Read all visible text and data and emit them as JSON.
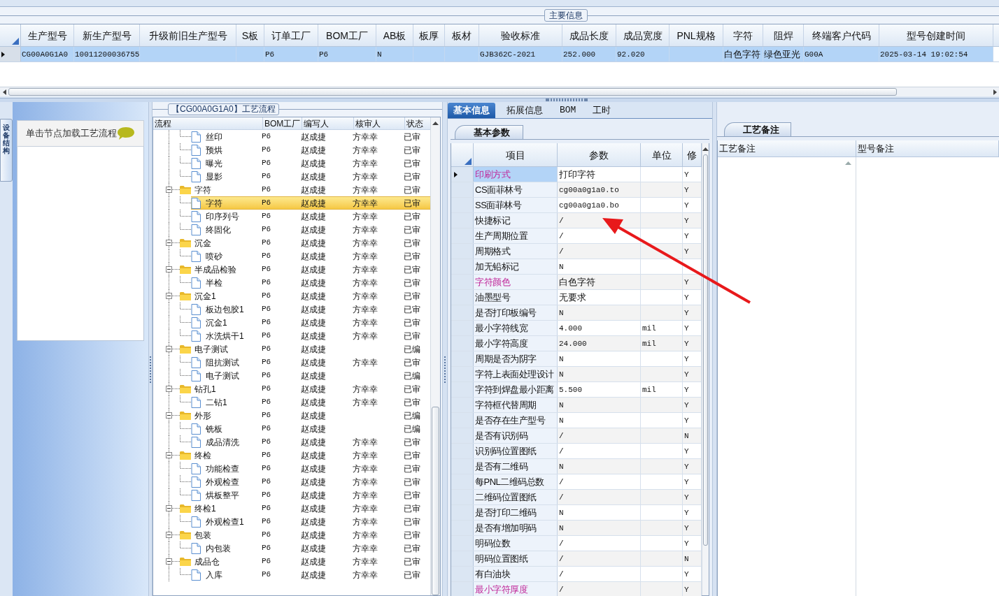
{
  "main_info": {
    "title": "主要信息",
    "row_selected": true,
    "columns": [
      {
        "header": "生产型号",
        "value": "CG00A0G1A0"
      },
      {
        "header": "新生产型号",
        "value": "10011200036755"
      },
      {
        "header": "升级前旧生产型号"
      },
      {
        "header": "S板"
      },
      {
        "header": "订单工厂",
        "value": "P6"
      },
      {
        "header": "BOM工厂",
        "value": "P6"
      },
      {
        "header": "AB板",
        "value": "N"
      },
      {
        "header": "板厚"
      },
      {
        "header": "板材"
      },
      {
        "header": "验收标准",
        "value": "GJB362C-2021"
      },
      {
        "header": "成品长度",
        "value": "252.000"
      },
      {
        "header": "成品宽度",
        "value": "92.020"
      },
      {
        "header": "PNL规格"
      },
      {
        "header": "字符",
        "value": "白色字符"
      },
      {
        "header": "阻焊",
        "value": "绿色亚光"
      },
      {
        "header": "终端客户代码",
        "value": "G00A"
      },
      {
        "header": "型号创建时间",
        "value": "2025-03-14 19:02:54"
      }
    ]
  },
  "side_tab": {
    "label": "设备结构"
  },
  "equipment_panel": {
    "hint": "单击节点加载工艺流程"
  },
  "process_flow": {
    "title": "【CG00A0G1A0】工艺流程",
    "columns": [
      "流程",
      "BOM工厂",
      "编写人",
      "核审人",
      "状态"
    ],
    "nodes": [
      {
        "kind": "step",
        "name": "丝印",
        "factory": "P6",
        "writer": "赵成捷",
        "reviewer": "方幸幸",
        "status": "已审",
        "selected": false
      },
      {
        "kind": "step",
        "name": "预烘",
        "factory": "P6",
        "writer": "赵成捷",
        "reviewer": "方幸幸",
        "status": "已审",
        "selected": false
      },
      {
        "kind": "step",
        "name": "曝光",
        "factory": "P6",
        "writer": "赵成捷",
        "reviewer": "方幸幸",
        "status": "已审",
        "selected": false
      },
      {
        "kind": "step",
        "name": "显影",
        "factory": "P6",
        "writer": "赵成捷",
        "reviewer": "方幸幸",
        "status": "已审",
        "selected": false
      },
      {
        "kind": "folder",
        "name": "字符",
        "factory": "P6",
        "writer": "赵成捷",
        "reviewer": "方幸幸",
        "status": "已审",
        "selected": false,
        "expanded": true,
        "children": [
          {
            "kind": "step",
            "name": "字符",
            "factory": "P6",
            "writer": "赵成捷",
            "reviewer": "方幸幸",
            "status": "已审",
            "selected": true
          },
          {
            "kind": "step",
            "name": "印序列号",
            "factory": "P6",
            "writer": "赵成捷",
            "reviewer": "方幸幸",
            "status": "已审",
            "selected": false
          },
          {
            "kind": "step",
            "name": "终固化",
            "factory": "P6",
            "writer": "赵成捷",
            "reviewer": "方幸幸",
            "status": "已审",
            "selected": false
          }
        ]
      },
      {
        "kind": "folder",
        "name": "沉金",
        "factory": "P6",
        "writer": "赵成捷",
        "reviewer": "方幸幸",
        "status": "已审",
        "selected": false,
        "expanded": true,
        "children": [
          {
            "kind": "step",
            "name": "喷砂",
            "factory": "P6",
            "writer": "赵成捷",
            "reviewer": "方幸幸",
            "status": "已审",
            "selected": false
          }
        ]
      },
      {
        "kind": "folder",
        "name": "半成品检验",
        "factory": "P6",
        "writer": "赵成捷",
        "reviewer": "方幸幸",
        "status": "已审",
        "selected": false,
        "expanded": true,
        "children": [
          {
            "kind": "step",
            "name": "半检",
            "factory": "P6",
            "writer": "赵成捷",
            "reviewer": "方幸幸",
            "status": "已审",
            "selected": false
          }
        ]
      },
      {
        "kind": "folder",
        "name": "沉金1",
        "factory": "P6",
        "writer": "赵成捷",
        "reviewer": "方幸幸",
        "status": "已审",
        "selected": false,
        "expanded": true,
        "children": [
          {
            "kind": "step",
            "name": "板边包胶1",
            "factory": "P6",
            "writer": "赵成捷",
            "reviewer": "方幸幸",
            "status": "已审",
            "selected": false
          },
          {
            "kind": "step",
            "name": "沉金1",
            "factory": "P6",
            "writer": "赵成捷",
            "reviewer": "方幸幸",
            "status": "已审",
            "selected": false
          },
          {
            "kind": "step",
            "name": "水洗烘干1",
            "factory": "P6",
            "writer": "赵成捷",
            "reviewer": "方幸幸",
            "status": "已审",
            "selected": false
          }
        ]
      },
      {
        "kind": "folder",
        "name": "电子测试",
        "factory": "P6",
        "writer": "赵成捷",
        "status": "已编",
        "selected": false,
        "expanded": true,
        "children": [
          {
            "kind": "step",
            "name": "阻抗测试",
            "factory": "P6",
            "writer": "赵成捷",
            "reviewer": "方幸幸",
            "status": "已审",
            "selected": false
          },
          {
            "kind": "step",
            "name": "电子测试",
            "factory": "P6",
            "writer": "赵成捷",
            "status": "已编",
            "selected": false
          }
        ]
      },
      {
        "kind": "folder",
        "name": "钻孔1",
        "factory": "P6",
        "writer": "赵成捷",
        "reviewer": "方幸幸",
        "status": "已审",
        "selected": false,
        "expanded": true,
        "children": [
          {
            "kind": "step",
            "name": "二钻1",
            "factory": "P6",
            "writer": "赵成捷",
            "reviewer": "方幸幸",
            "status": "已审",
            "selected": false
          }
        ]
      },
      {
        "kind": "folder",
        "name": "外形",
        "factory": "P6",
        "writer": "赵成捷",
        "status": "已编",
        "selected": false,
        "expanded": true,
        "children": [
          {
            "kind": "step",
            "name": "铣板",
            "factory": "P6",
            "writer": "赵成捷",
            "status": "已编",
            "selected": false
          },
          {
            "kind": "step",
            "name": "成品清洗",
            "factory": "P6",
            "writer": "赵成捷",
            "reviewer": "方幸幸",
            "status": "已审",
            "selected": false
          }
        ]
      },
      {
        "kind": "folder",
        "name": "终检",
        "factory": "P6",
        "writer": "赵成捷",
        "reviewer": "方幸幸",
        "status": "已审",
        "selected": false,
        "expanded": true,
        "children": [
          {
            "kind": "step",
            "name": "功能检查",
            "factory": "P6",
            "writer": "赵成捷",
            "reviewer": "方幸幸",
            "status": "已审",
            "selected": false
          },
          {
            "kind": "step",
            "name": "外观检查",
            "factory": "P6",
            "writer": "赵成捷",
            "reviewer": "方幸幸",
            "status": "已审",
            "selected": false
          },
          {
            "kind": "step",
            "name": "烘板整平",
            "factory": "P6",
            "writer": "赵成捷",
            "reviewer": "方幸幸",
            "status": "已审",
            "selected": false
          }
        ]
      },
      {
        "kind": "folder",
        "name": "终检1",
        "factory": "P6",
        "writer": "赵成捷",
        "reviewer": "方幸幸",
        "status": "已审",
        "selected": false,
        "expanded": true,
        "children": [
          {
            "kind": "step",
            "name": "外观检查1",
            "factory": "P6",
            "writer": "赵成捷",
            "reviewer": "方幸幸",
            "status": "已审",
            "selected": false
          }
        ]
      },
      {
        "kind": "folder",
        "name": "包装",
        "factory": "P6",
        "writer": "赵成捷",
        "reviewer": "方幸幸",
        "status": "已审",
        "selected": false,
        "expanded": true,
        "children": [
          {
            "kind": "step",
            "name": "内包装",
            "factory": "P6",
            "writer": "赵成捷",
            "reviewer": "方幸幸",
            "status": "已审",
            "selected": false
          }
        ]
      },
      {
        "kind": "folder",
        "name": "成品仓",
        "factory": "P6",
        "writer": "赵成捷",
        "reviewer": "方幸幸",
        "status": "已审",
        "selected": false,
        "expanded": true,
        "children": [
          {
            "kind": "step",
            "name": "入库",
            "factory": "P6",
            "writer": "赵成捷",
            "reviewer": "方幸幸",
            "status": "已审",
            "selected": false
          }
        ]
      }
    ]
  },
  "detail_tabs": [
    {
      "label": "基本信息",
      "selected": true
    },
    {
      "label": "拓展信息",
      "selected": false
    },
    {
      "label": "BOM",
      "selected": false
    },
    {
      "label": "工时",
      "selected": false
    }
  ],
  "params": {
    "tab": "基本参数",
    "columns": [
      "项目",
      "参数",
      "单位",
      "修"
    ],
    "rows": [
      {
        "item": "印刷方式",
        "value": "打印字符",
        "modify": "Y",
        "flagged": true,
        "selected": true
      },
      {
        "item": "CS面菲林号",
        "value": "cg00a0g1a0.to",
        "modify": "Y",
        "flagged": false,
        "selected": false
      },
      {
        "item": "SS面菲林号",
        "value": "cg00a0g1a0.bo",
        "modify": "Y",
        "flagged": false,
        "selected": false
      },
      {
        "item": "快捷标记",
        "value": "/",
        "modify": "Y",
        "flagged": false,
        "selected": false
      },
      {
        "item": "生产周期位置",
        "value": "/",
        "modify": "Y",
        "flagged": false,
        "selected": false
      },
      {
        "item": "周期格式",
        "value": "/",
        "modify": "Y",
        "flagged": false,
        "selected": false
      },
      {
        "item": "加无铅标记",
        "value": "N",
        "flagged": false,
        "selected": false
      },
      {
        "item": "字符颜色",
        "value": "白色字符",
        "modify": "Y",
        "flagged": true,
        "selected": false
      },
      {
        "item": "油墨型号",
        "value": "无要求",
        "modify": "Y",
        "flagged": false,
        "selected": false
      },
      {
        "item": "是否打印板编号",
        "value": "N",
        "modify": "Y",
        "flagged": false,
        "selected": false
      },
      {
        "item": "最小字符线宽",
        "value": "4.000",
        "unit": "mil",
        "modify": "Y",
        "flagged": false,
        "selected": false
      },
      {
        "item": "最小字符高度",
        "value": "24.000",
        "unit": "mil",
        "modify": "Y",
        "flagged": false,
        "selected": false
      },
      {
        "item": "周期是否为阴字",
        "value": "N",
        "modify": "Y",
        "flagged": false,
        "selected": false
      },
      {
        "item": "字符上表面处理设计",
        "value": "N",
        "modify": "Y",
        "flagged": false,
        "selected": false
      },
      {
        "item": "字符到焊盘最小距离",
        "value": "5.500",
        "unit": "mil",
        "modify": "Y",
        "flagged": false,
        "selected": false
      },
      {
        "item": "字符框代替周期",
        "value": "N",
        "modify": "Y",
        "flagged": false,
        "selected": false
      },
      {
        "item": "是否存在生产型号",
        "value": "N",
        "modify": "Y",
        "flagged": false,
        "selected": false
      },
      {
        "item": "是否有识别码",
        "value": "/",
        "modify": "N",
        "flagged": false,
        "selected": false
      },
      {
        "item": "识别码位置图纸",
        "value": "/",
        "modify": "Y",
        "flagged": false,
        "selected": false
      },
      {
        "item": "是否有二维码",
        "value": "N",
        "modify": "Y",
        "flagged": false,
        "selected": false
      },
      {
        "item": "每PNL二维码总数",
        "value": "/",
        "modify": "Y",
        "flagged": false,
        "selected": false
      },
      {
        "item": "二维码位置图纸",
        "value": "/",
        "modify": "Y",
        "flagged": false,
        "selected": false
      },
      {
        "item": "是否打印二维码",
        "value": "N",
        "modify": "Y",
        "flagged": false,
        "selected": false
      },
      {
        "item": "是否有增加明码",
        "value": "N",
        "modify": "Y",
        "flagged": false,
        "selected": false
      },
      {
        "item": "明码位数",
        "value": "/",
        "modify": "Y",
        "flagged": false,
        "selected": false
      },
      {
        "item": "明码位置图纸",
        "value": "/",
        "modify": "N",
        "flagged": false,
        "selected": false
      },
      {
        "item": "有白油块",
        "value": "/",
        "modify": "Y",
        "flagged": false,
        "selected": false
      },
      {
        "item": "最小字符厚度",
        "value": "/",
        "modify": "Y",
        "flagged": true,
        "selected": false
      }
    ]
  },
  "notes": {
    "tab": "工艺备注",
    "columns": [
      "工艺备注",
      "型号备注"
    ]
  }
}
